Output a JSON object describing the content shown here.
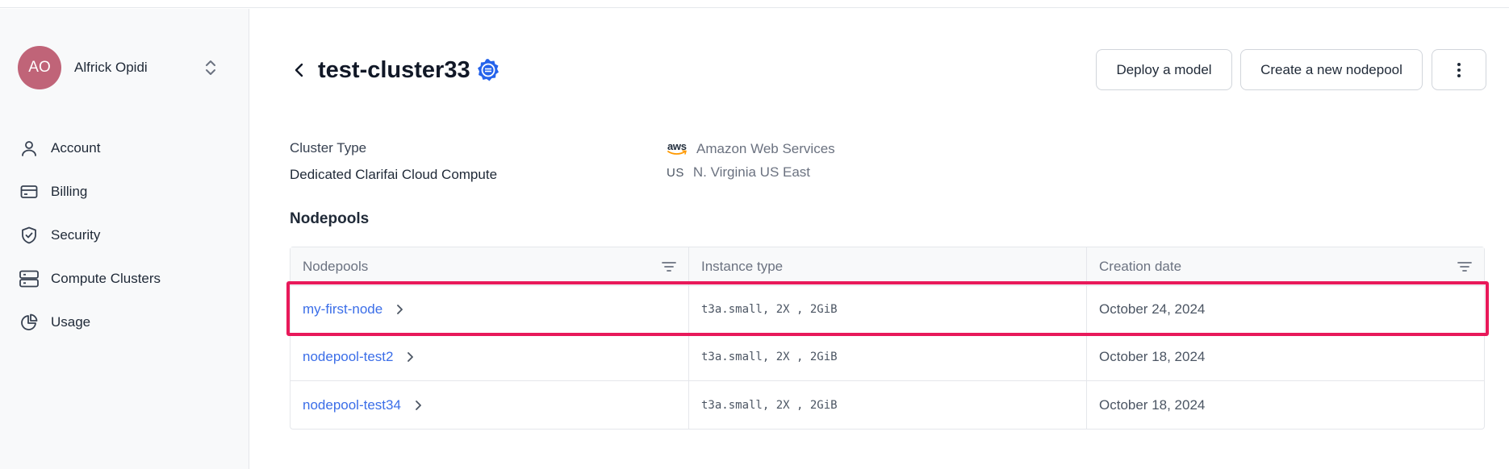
{
  "user": {
    "initials": "AO",
    "name": "Alfrick Opidi",
    "avatar_color": "#c06478"
  },
  "sidebar": {
    "items": [
      {
        "label": "Account",
        "icon": "user-icon"
      },
      {
        "label": "Billing",
        "icon": "credit-card-icon"
      },
      {
        "label": "Security",
        "icon": "shield-icon"
      },
      {
        "label": "Compute Clusters",
        "icon": "server-icon"
      },
      {
        "label": "Usage",
        "icon": "pie-chart-icon"
      }
    ]
  },
  "header": {
    "title": "test-cluster33",
    "buttons": {
      "deploy": "Deploy a model",
      "create": "Create a new nodepool"
    }
  },
  "cluster": {
    "type_label": "Cluster Type",
    "type_value": "Dedicated Clarifai Cloud Compute",
    "provider_logo_text": "aws",
    "provider": "Amazon Web Services",
    "region_code": "US",
    "region": "N. Virginia US East"
  },
  "nodepools": {
    "section_title": "Nodepools",
    "columns": [
      "Nodepools",
      "Instance type",
      "Creation date"
    ],
    "rows": [
      {
        "name": "my-first-node",
        "instance": "t3a.small, 2X , 2GiB",
        "date": "October 24, 2024"
      },
      {
        "name": "nodepool-test2",
        "instance": "t3a.small, 2X , 2GiB",
        "date": "October 18, 2024"
      },
      {
        "name": "nodepool-test34",
        "instance": "t3a.small, 2X , 2GiB",
        "date": "October 18, 2024"
      }
    ]
  },
  "colors": {
    "accent_link": "#3b6ee8",
    "highlight": "#e8195a",
    "verified_badge": "#2563eb"
  }
}
